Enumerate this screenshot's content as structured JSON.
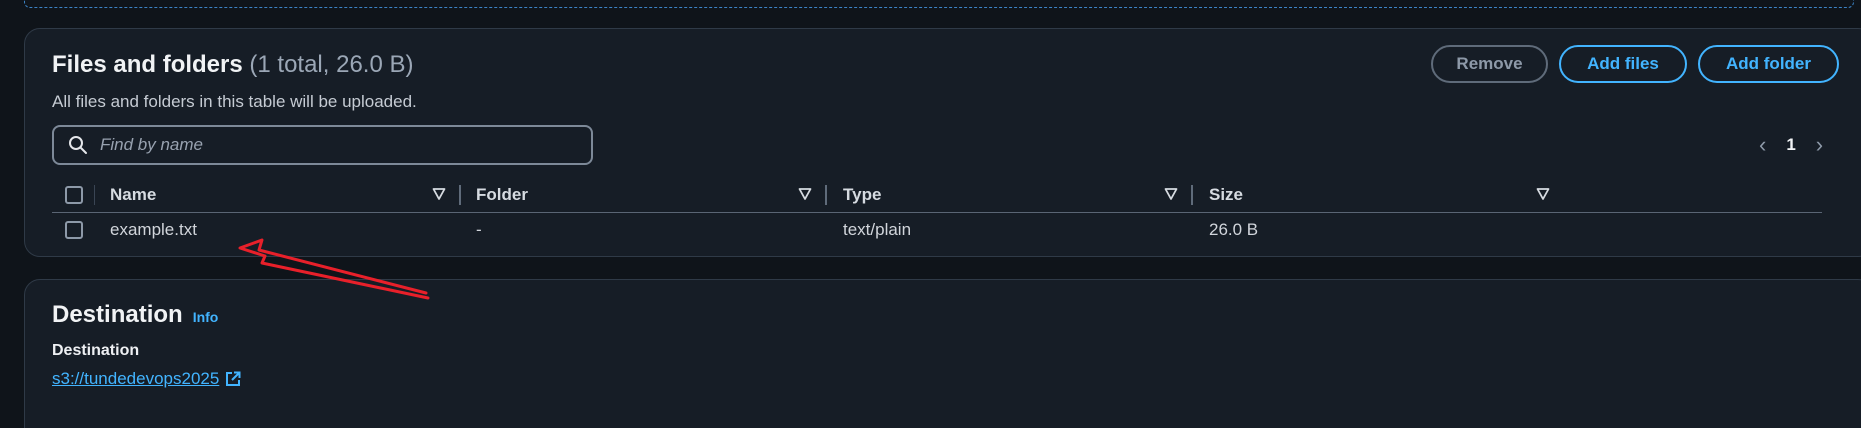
{
  "files_panel": {
    "title": "Files and folders",
    "counter": "(1 total, 26.0 B)",
    "description": "All files and folders in this table will be uploaded.",
    "buttons": {
      "remove": "Remove",
      "add_files": "Add files",
      "add_folder": "Add folder"
    },
    "search": {
      "placeholder": "Find by name",
      "value": ""
    },
    "pagination": {
      "current_page": "1",
      "prev_icon": "chevron-left-icon",
      "next_icon": "chevron-right-icon"
    },
    "table": {
      "columns": [
        "Name",
        "Folder",
        "Type",
        "Size"
      ],
      "rows": [
        {
          "name": "example.txt",
          "folder": "-",
          "type": "text/plain",
          "size": "26.0 B"
        }
      ]
    }
  },
  "destination_panel": {
    "title": "Destination",
    "info": "Info",
    "label": "Destination",
    "link": "s3://tundedevops2025",
    "link_icon": "external-link-icon"
  },
  "colors": {
    "background": "#0f141a",
    "panel": "#161d26",
    "accent": "#42b4ff",
    "annotation_arrow": "#e8202a"
  }
}
